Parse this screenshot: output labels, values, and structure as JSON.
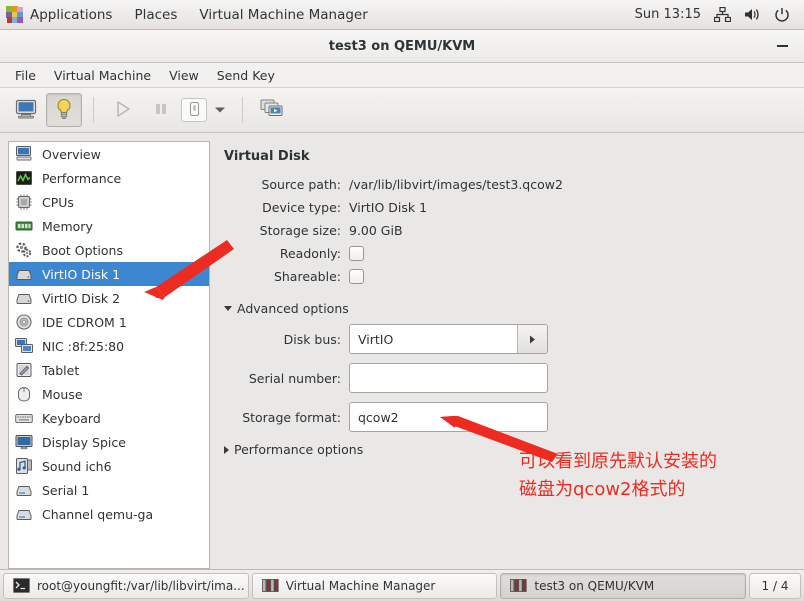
{
  "panel": {
    "logo_icon": "gnome-applications-icon",
    "items": [
      {
        "label": "Applications",
        "icon": "gnome-applications-icon"
      },
      {
        "label": "Places",
        "icon": ""
      },
      {
        "label": "Virtual Machine Manager",
        "icon": ""
      }
    ],
    "clock": "Sun 13:15",
    "tray": [
      {
        "icon": "network-icon"
      },
      {
        "icon": "volume-icon"
      },
      {
        "icon": "power-icon"
      }
    ]
  },
  "window": {
    "title": "test3 on QEMU/KVM",
    "minimize_icon": "minimize-icon",
    "menus": [
      "File",
      "Virtual Machine",
      "View",
      "Send Key"
    ],
    "toolbar": [
      {
        "name": "console-view-button",
        "icon": "monitor-icon",
        "state": "normal"
      },
      {
        "name": "details-view-button",
        "icon": "lightbulb-icon",
        "state": "pressed"
      },
      {
        "name": "separator-1",
        "icon": "separator",
        "state": "sep"
      },
      {
        "name": "run-button",
        "icon": "play-icon",
        "state": "disabled"
      },
      {
        "name": "pause-button",
        "icon": "pause-icon",
        "state": "disabled"
      },
      {
        "name": "shutdown-button",
        "icon": "shutdown-icon",
        "state": "framed"
      },
      {
        "name": "shutdown-menu-button",
        "icon": "chevron-down-icon",
        "state": "arrow"
      },
      {
        "name": "separator-2",
        "icon": "separator",
        "state": "sep"
      },
      {
        "name": "snapshots-button",
        "icon": "snapshots-icon",
        "state": "normal"
      }
    ]
  },
  "sidebar": {
    "items": [
      {
        "label": "Overview",
        "icon": "computer-icon",
        "selected": false
      },
      {
        "label": "Performance",
        "icon": "chart-icon",
        "selected": false
      },
      {
        "label": "CPUs",
        "icon": "cpu-icon",
        "selected": false
      },
      {
        "label": "Memory",
        "icon": "memory-icon",
        "selected": false
      },
      {
        "label": "Boot Options",
        "icon": "gears-icon",
        "selected": false
      },
      {
        "label": "VirtIO Disk 1",
        "icon": "harddisk-icon",
        "selected": true
      },
      {
        "label": "VirtIO Disk 2",
        "icon": "harddisk-icon",
        "selected": false
      },
      {
        "label": "IDE CDROM 1",
        "icon": "cdrom-icon",
        "selected": false
      },
      {
        "label": "NIC :8f:25:80",
        "icon": "network-card-icon",
        "selected": false
      },
      {
        "label": "Tablet",
        "icon": "tablet-icon",
        "selected": false
      },
      {
        "label": "Mouse",
        "icon": "mouse-icon",
        "selected": false
      },
      {
        "label": "Keyboard",
        "icon": "keyboard-icon",
        "selected": false
      },
      {
        "label": "Display Spice",
        "icon": "display-icon",
        "selected": false
      },
      {
        "label": "Sound ich6",
        "icon": "sound-icon",
        "selected": false
      },
      {
        "label": "Serial 1",
        "icon": "serial-icon",
        "selected": false
      },
      {
        "label": "Channel qemu-ga",
        "icon": "channel-icon",
        "selected": false
      }
    ],
    "selected_color": "#3d86d0"
  },
  "detail": {
    "title": "Virtual Disk",
    "fields": [
      {
        "label": "Source path:",
        "value": "/var/lib/libvirt/images/test3.qcow2"
      },
      {
        "label": "Device type:",
        "value": "VirtIO Disk 1"
      },
      {
        "label": "Storage size:",
        "value": "9.00 GiB"
      }
    ],
    "checkboxes": [
      {
        "label": "Readonly:",
        "checked": false
      },
      {
        "label": "Shareable:",
        "checked": false
      }
    ],
    "advanced": {
      "expander_label": "Advanced options",
      "expanded": true,
      "disk_bus": {
        "label": "Disk bus:",
        "value": "VirtIO",
        "placeholder": ""
      },
      "serial_number": {
        "label": "Serial number:",
        "value": "",
        "placeholder": ""
      },
      "storage_format": {
        "label": "Storage format:",
        "value": "qcow2",
        "placeholder": ""
      }
    },
    "performance": {
      "expander_label": "Performance options",
      "expanded": false
    }
  },
  "annotations": {
    "color": "#ee2b20",
    "note_line1": "可以看到原先默认安装的",
    "note_line2": "磁盘为qcow2格式的",
    "arrow_sidebar": "arrow-pointing-to-virtio-disk-1",
    "arrow_format": "arrow-pointing-to-storage-format"
  },
  "taskbar": {
    "buttons": [
      {
        "label": "root@youngfit:/var/lib/libvirt/ima...",
        "icon": "terminal-icon",
        "active": false
      },
      {
        "label": "Virtual Machine Manager",
        "icon": "vmm-icon",
        "active": false
      },
      {
        "label": "test3 on QEMU/KVM",
        "icon": "vmm-icon",
        "active": true
      }
    ],
    "pager": "1 / 4"
  }
}
